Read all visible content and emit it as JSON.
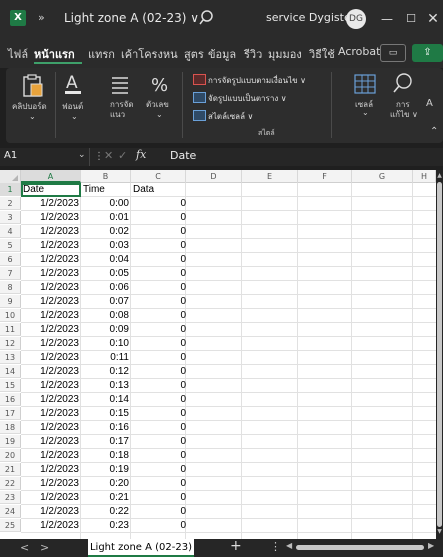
{
  "titlebar": {
    "qa_more": "»",
    "doc_title": "Light zone A (02-23) ∨",
    "account": "service Dygistech",
    "avatar_text": "DG",
    "min": "—",
    "max": "☐",
    "close": "✕"
  },
  "ribbon_tabs": [
    "ไฟล์",
    "หน้าแรก",
    "แทรก",
    "เค้าโครงหน",
    "สูตร",
    "ข้อมูล",
    "รีวิว",
    "มุมมอง",
    "วิธีใช้",
    "Acrobat"
  ],
  "active_tab_index": 1,
  "ribbon": {
    "clipboard": "คลิปบอร์ด",
    "font": "ฟอนต์",
    "alignment_l1": "การจัด",
    "alignment_l2": "แนว",
    "number": "ตัวเลข",
    "conditional_format": "การจัดรูปแบบตามเงื่อนไข ∨",
    "format_table": "จัดรูปแบบเป็นตาราง ∨",
    "cell_styles": "สไตล์เซลล์ ∨",
    "styles_group": "สไตล์",
    "cells": "เซลล์",
    "editing_l1": "การ",
    "editing_l2": "แก้ไข ∨",
    "more_letter": "A"
  },
  "formula_bar": {
    "name_box": "A1",
    "content": "Date"
  },
  "columns": [
    "A",
    "B",
    "C",
    "D",
    "E",
    "F",
    "G",
    "H"
  ],
  "selected_column": "A",
  "rows": [
    {
      "n": "1",
      "a": "Date",
      "b": "Time",
      "c": "Data"
    },
    {
      "n": "2",
      "a": "1/2/2023",
      "b": "0:00",
      "c": "0"
    },
    {
      "n": "3",
      "a": "1/2/2023",
      "b": "0:01",
      "c": "0"
    },
    {
      "n": "4",
      "a": "1/2/2023",
      "b": "0:02",
      "c": "0"
    },
    {
      "n": "5",
      "a": "1/2/2023",
      "b": "0:03",
      "c": "0"
    },
    {
      "n": "6",
      "a": "1/2/2023",
      "b": "0:04",
      "c": "0"
    },
    {
      "n": "7",
      "a": "1/2/2023",
      "b": "0:05",
      "c": "0"
    },
    {
      "n": "8",
      "a": "1/2/2023",
      "b": "0:06",
      "c": "0"
    },
    {
      "n": "9",
      "a": "1/2/2023",
      "b": "0:07",
      "c": "0"
    },
    {
      "n": "10",
      "a": "1/2/2023",
      "b": "0:08",
      "c": "0"
    },
    {
      "n": "11",
      "a": "1/2/2023",
      "b": "0:09",
      "c": "0"
    },
    {
      "n": "12",
      "a": "1/2/2023",
      "b": "0:10",
      "c": "0"
    },
    {
      "n": "13",
      "a": "1/2/2023",
      "b": "0:11",
      "c": "0"
    },
    {
      "n": "14",
      "a": "1/2/2023",
      "b": "0:12",
      "c": "0"
    },
    {
      "n": "15",
      "a": "1/2/2023",
      "b": "0:13",
      "c": "0"
    },
    {
      "n": "16",
      "a": "1/2/2023",
      "b": "0:14",
      "c": "0"
    },
    {
      "n": "17",
      "a": "1/2/2023",
      "b": "0:15",
      "c": "0"
    },
    {
      "n": "18",
      "a": "1/2/2023",
      "b": "0:16",
      "c": "0"
    },
    {
      "n": "19",
      "a": "1/2/2023",
      "b": "0:17",
      "c": "0"
    },
    {
      "n": "20",
      "a": "1/2/2023",
      "b": "0:18",
      "c": "0"
    },
    {
      "n": "21",
      "a": "1/2/2023",
      "b": "0:19",
      "c": "0"
    },
    {
      "n": "22",
      "a": "1/2/2023",
      "b": "0:20",
      "c": "0"
    },
    {
      "n": "23",
      "a": "1/2/2023",
      "b": "0:21",
      "c": "0"
    },
    {
      "n": "24",
      "a": "1/2/2023",
      "b": "0:22",
      "c": "0"
    },
    {
      "n": "25",
      "a": "1/2/2023",
      "b": "0:23",
      "c": "0"
    }
  ],
  "sheetbar": {
    "prev": "<",
    "next": ">",
    "sheet_name": "Light zone A (02-23)",
    "add": "+",
    "options": "⋮"
  },
  "colors": {
    "accent": "#1f7a45",
    "titlebar": "#2b2b2b",
    "grid_bg": "#ffffff"
  }
}
